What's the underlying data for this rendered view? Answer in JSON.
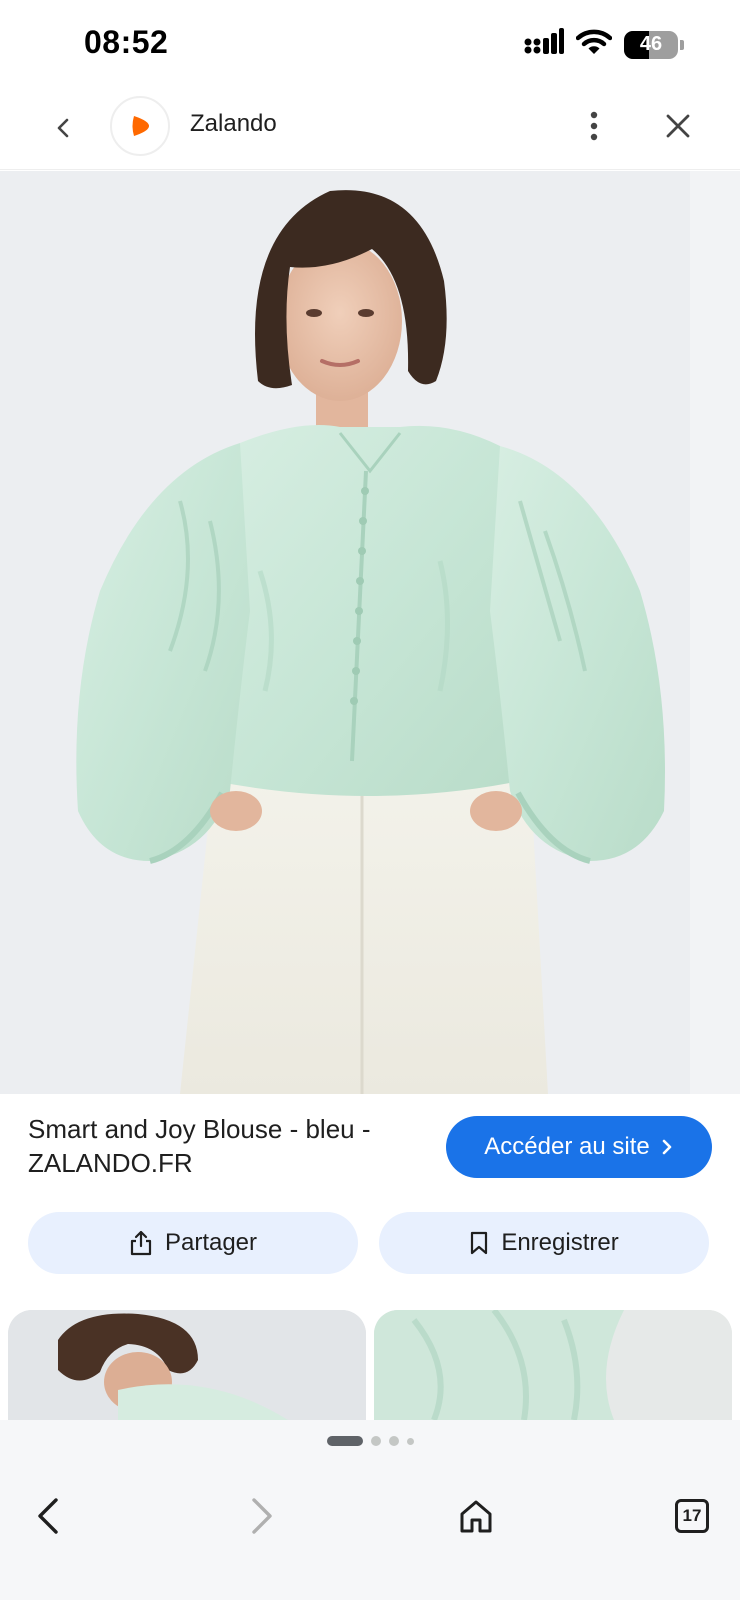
{
  "status_bar": {
    "time": "08:52",
    "battery": "46",
    "battery_level": 0.46,
    "icons": [
      "signal-icon",
      "wifi-icon",
      "battery-icon"
    ]
  },
  "header": {
    "back_icon": "chevron-left-icon",
    "site_name": "Zalando",
    "logo_icon": "zalando-logo",
    "more_icon": "more-vertical-icon",
    "close_icon": "close-icon"
  },
  "hero": {
    "image": "product-photo",
    "colors": {
      "blouse": "#cfe9dc",
      "pants": "#f1efe6",
      "hair": "#3c2a20",
      "skin": "#e9c3ad"
    }
  },
  "product": {
    "title": "Smart and Joy Blouse - bleu - ZALANDO.FR"
  },
  "actions": {
    "visit_label": "Accéder au site",
    "share_label": "Partager",
    "save_label": "Enregistrer"
  },
  "thumbnails": [
    "thumbnail-image",
    "thumbnail-image"
  ],
  "pager": {
    "pages": 4,
    "active": 1
  },
  "bottom_nav": {
    "back_icon": "back-arrow-icon",
    "forward_icon": "forward-arrow-icon",
    "home_icon": "home-icon",
    "tabs_count": "17"
  },
  "colors": {
    "accent": "#1a73e8",
    "chip": "#e8f0fe",
    "logo": "#ff6900"
  }
}
